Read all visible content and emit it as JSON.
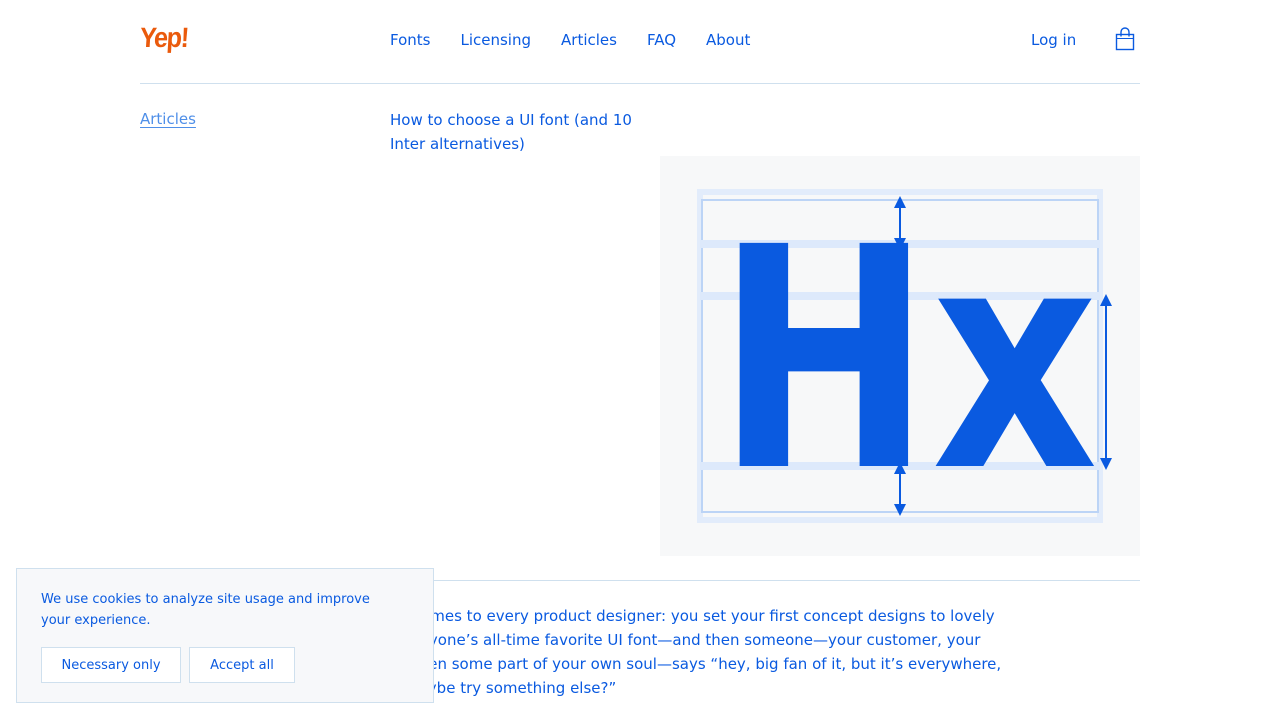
{
  "header": {
    "logo": "Yep!",
    "nav": [
      "Fonts",
      "Licensing",
      "Articles",
      "FAQ",
      "About"
    ],
    "login": "Log in",
    "cart_icon": "shopping-bag-icon"
  },
  "breadcrumb": {
    "label": "Articles"
  },
  "article": {
    "title": "How to choose a UI font (and 10 Inter alternatives)",
    "hero_glyphs": "Hx",
    "body_lines": [
      "ay comes to every product designer: you set your first concept designs to lovely",
      "-everyone’s all-time favorite UI font—and then someone—your customer, your",
      "or even some part of your own soul—says “hey, big fan of it, but it’s everywhere,",
      "e maybe try something else?”"
    ]
  },
  "cookie": {
    "text": "We use cookies to analyze site usage and improve your experience.",
    "necessary_label": "Necessary only",
    "accept_label": "Accept all"
  },
  "colors": {
    "accent": "#0a5ae0",
    "logo": "#ea5a0c",
    "hero_bg": "#f7f8f9",
    "divider": "#cfe0ee"
  }
}
